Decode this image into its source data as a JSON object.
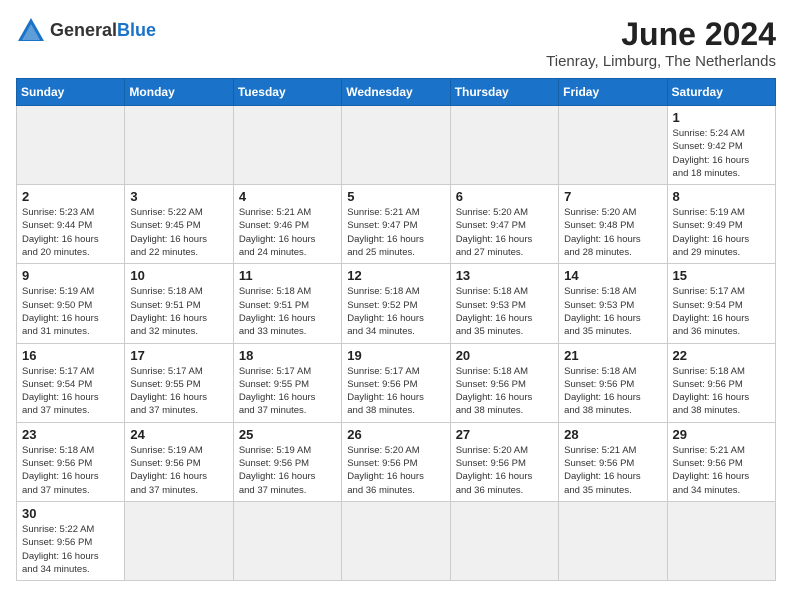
{
  "header": {
    "logo_general": "General",
    "logo_blue": "Blue",
    "month": "June 2024",
    "location": "Tienray, Limburg, The Netherlands"
  },
  "weekdays": [
    "Sunday",
    "Monday",
    "Tuesday",
    "Wednesday",
    "Thursday",
    "Friday",
    "Saturday"
  ],
  "days": [
    {
      "date": "",
      "info": ""
    },
    {
      "date": "",
      "info": ""
    },
    {
      "date": "",
      "info": ""
    },
    {
      "date": "",
      "info": ""
    },
    {
      "date": "",
      "info": ""
    },
    {
      "date": "",
      "info": ""
    },
    {
      "date": "1",
      "info": "Sunrise: 5:24 AM\nSunset: 9:42 PM\nDaylight: 16 hours\nand 18 minutes."
    },
    {
      "date": "2",
      "info": "Sunrise: 5:23 AM\nSunset: 9:44 PM\nDaylight: 16 hours\nand 20 minutes."
    },
    {
      "date": "3",
      "info": "Sunrise: 5:22 AM\nSunset: 9:45 PM\nDaylight: 16 hours\nand 22 minutes."
    },
    {
      "date": "4",
      "info": "Sunrise: 5:21 AM\nSunset: 9:46 PM\nDaylight: 16 hours\nand 24 minutes."
    },
    {
      "date": "5",
      "info": "Sunrise: 5:21 AM\nSunset: 9:47 PM\nDaylight: 16 hours\nand 25 minutes."
    },
    {
      "date": "6",
      "info": "Sunrise: 5:20 AM\nSunset: 9:47 PM\nDaylight: 16 hours\nand 27 minutes."
    },
    {
      "date": "7",
      "info": "Sunrise: 5:20 AM\nSunset: 9:48 PM\nDaylight: 16 hours\nand 28 minutes."
    },
    {
      "date": "8",
      "info": "Sunrise: 5:19 AM\nSunset: 9:49 PM\nDaylight: 16 hours\nand 29 minutes."
    },
    {
      "date": "9",
      "info": "Sunrise: 5:19 AM\nSunset: 9:50 PM\nDaylight: 16 hours\nand 31 minutes."
    },
    {
      "date": "10",
      "info": "Sunrise: 5:18 AM\nSunset: 9:51 PM\nDaylight: 16 hours\nand 32 minutes."
    },
    {
      "date": "11",
      "info": "Sunrise: 5:18 AM\nSunset: 9:51 PM\nDaylight: 16 hours\nand 33 minutes."
    },
    {
      "date": "12",
      "info": "Sunrise: 5:18 AM\nSunset: 9:52 PM\nDaylight: 16 hours\nand 34 minutes."
    },
    {
      "date": "13",
      "info": "Sunrise: 5:18 AM\nSunset: 9:53 PM\nDaylight: 16 hours\nand 35 minutes."
    },
    {
      "date": "14",
      "info": "Sunrise: 5:18 AM\nSunset: 9:53 PM\nDaylight: 16 hours\nand 35 minutes."
    },
    {
      "date": "15",
      "info": "Sunrise: 5:17 AM\nSunset: 9:54 PM\nDaylight: 16 hours\nand 36 minutes."
    },
    {
      "date": "16",
      "info": "Sunrise: 5:17 AM\nSunset: 9:54 PM\nDaylight: 16 hours\nand 37 minutes."
    },
    {
      "date": "17",
      "info": "Sunrise: 5:17 AM\nSunset: 9:55 PM\nDaylight: 16 hours\nand 37 minutes."
    },
    {
      "date": "18",
      "info": "Sunrise: 5:17 AM\nSunset: 9:55 PM\nDaylight: 16 hours\nand 37 minutes."
    },
    {
      "date": "19",
      "info": "Sunrise: 5:17 AM\nSunset: 9:56 PM\nDaylight: 16 hours\nand 38 minutes."
    },
    {
      "date": "20",
      "info": "Sunrise: 5:18 AM\nSunset: 9:56 PM\nDaylight: 16 hours\nand 38 minutes."
    },
    {
      "date": "21",
      "info": "Sunrise: 5:18 AM\nSunset: 9:56 PM\nDaylight: 16 hours\nand 38 minutes."
    },
    {
      "date": "22",
      "info": "Sunrise: 5:18 AM\nSunset: 9:56 PM\nDaylight: 16 hours\nand 38 minutes."
    },
    {
      "date": "23",
      "info": "Sunrise: 5:18 AM\nSunset: 9:56 PM\nDaylight: 16 hours\nand 37 minutes."
    },
    {
      "date": "24",
      "info": "Sunrise: 5:19 AM\nSunset: 9:56 PM\nDaylight: 16 hours\nand 37 minutes."
    },
    {
      "date": "25",
      "info": "Sunrise: 5:19 AM\nSunset: 9:56 PM\nDaylight: 16 hours\nand 37 minutes."
    },
    {
      "date": "26",
      "info": "Sunrise: 5:20 AM\nSunset: 9:56 PM\nDaylight: 16 hours\nand 36 minutes."
    },
    {
      "date": "27",
      "info": "Sunrise: 5:20 AM\nSunset: 9:56 PM\nDaylight: 16 hours\nand 36 minutes."
    },
    {
      "date": "28",
      "info": "Sunrise: 5:21 AM\nSunset: 9:56 PM\nDaylight: 16 hours\nand 35 minutes."
    },
    {
      "date": "29",
      "info": "Sunrise: 5:21 AM\nSunset: 9:56 PM\nDaylight: 16 hours\nand 34 minutes."
    },
    {
      "date": "30",
      "info": "Sunrise: 5:22 AM\nSunset: 9:56 PM\nDaylight: 16 hours\nand 34 minutes."
    }
  ]
}
